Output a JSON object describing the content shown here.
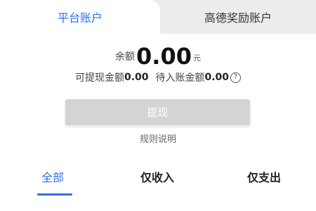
{
  "top_tabs": {
    "platform_account": "平台账户",
    "amap_reward_account": "高德奖励账户"
  },
  "balance": {
    "label": "余额",
    "amount": "0.00",
    "unit": "元"
  },
  "amounts": {
    "withdrawable_label": "可提现金额",
    "withdrawable_value": "0.00",
    "pending_label": "待入账金额",
    "pending_value": "0.00",
    "help_icon": "?"
  },
  "actions": {
    "withdraw_label": "提现",
    "rules_label": "规则说明"
  },
  "filter_tabs": {
    "all": "全部",
    "income_only": "仅收入",
    "expense_only": "仅支出"
  },
  "colors": {
    "accent": "#2f6fe8",
    "disabled_button": "#d4d4d4"
  }
}
